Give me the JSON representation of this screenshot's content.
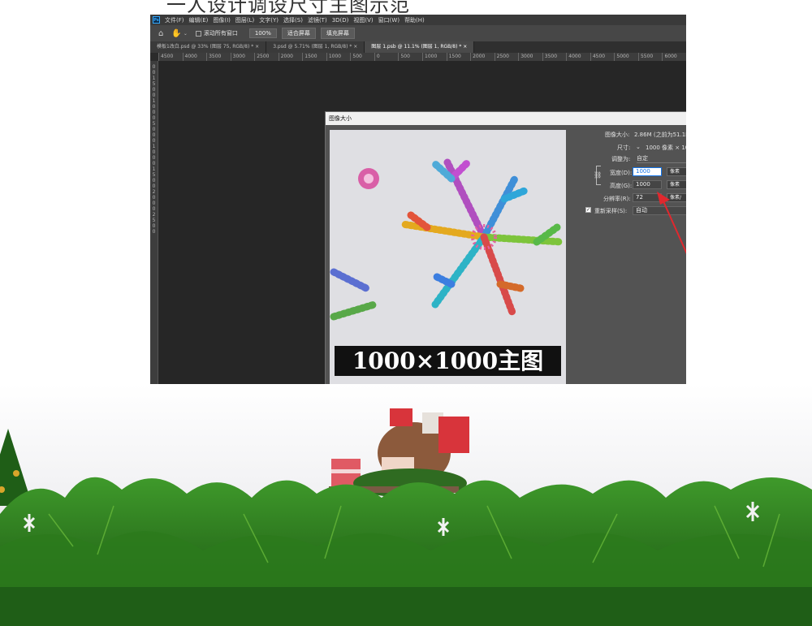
{
  "caption": "一人设计调设尺寸主图示范",
  "photoshop": {
    "app_icon": "Ps",
    "menu": [
      "文件(F)",
      "编辑(E)",
      "图像(I)",
      "图层(L)",
      "文字(Y)",
      "选择(S)",
      "滤镜(T)",
      "3D(D)",
      "视图(V)",
      "窗口(W)",
      "帮助(H)"
    ],
    "options": {
      "home_icon": "home-icon",
      "hand_icon": "hand-icon",
      "scroll_all_label": "滚动所有窗口",
      "zoom_value": "100%",
      "fit_screen_label": "适合屏幕",
      "fill_screen_label": "填充屏幕"
    },
    "tabs": [
      {
        "label": "模板1改白.psd @ 33% (图层 75, RGB/8) *",
        "active": false
      },
      {
        "label": "3.psd @ 5.71% (图层 1, RGB/8) *",
        "active": false
      },
      {
        "label": "图层 1.psb @ 11.1% (图层 1, RGB/8) *",
        "active": true
      }
    ],
    "ruler_h": [
      "4500",
      "4000",
      "3500",
      "3000",
      "2500",
      "2000",
      "1500",
      "1000",
      "500",
      "0",
      "500",
      "1000",
      "1500",
      "2000",
      "2500",
      "3000",
      "3500",
      "4000",
      "4500",
      "5000",
      "5500",
      "6000"
    ],
    "ruler_v": "0 0 1 5 0 0 1 0 0 0 5 0 0 0 1 0 0 0 1 5 0 0 2 0 0 0 2 5 0 0",
    "dialog": {
      "title": "图像大小",
      "image_size_label": "图像大小:",
      "image_size_value": "2.86M (之前为51.1M)",
      "dimensions_label": "尺寸:",
      "dimensions_value": "1000 像素 × 10",
      "fit_to_label": "调整为:",
      "fit_to_value": "自定",
      "width_label": "宽度(D):",
      "width_value": "1000",
      "width_unit": "像素",
      "height_label": "高度(G):",
      "height_value": "1000",
      "height_unit": "像素",
      "resolution_label": "分辨率(R):",
      "resolution_value": "72",
      "resolution_unit": "像素/",
      "resample_label": "重新采样(S):",
      "resample_value": "自动",
      "resample_checked": true,
      "preview_banner": "1000×1000主图"
    }
  },
  "colors": {
    "ps_background": "#2b2b2b",
    "accent_blue": "#1473e6",
    "arrow_red": "#e0282e",
    "pine_green": "#2f7d1e"
  }
}
